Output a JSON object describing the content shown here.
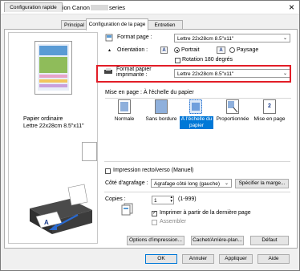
{
  "window": {
    "title_before": "Options d'impression Canon",
    "title_after": "series",
    "close_glyph": "×"
  },
  "tabs": [
    "Configuration rapide",
    "Principal",
    "Configuration de la page",
    "Entretien"
  ],
  "active_tab": 2,
  "preview": {
    "paper_type": "Papier ordinaire",
    "paper_size": "Lettre 22x28cm 8.5\"x11\""
  },
  "page_size": {
    "label": "Format page :",
    "value": "Lettre 22x28cm 8.5\"x11\""
  },
  "orientation": {
    "label": "Orientation :",
    "portrait": "Portrait",
    "landscape": "Paysage",
    "rotate180": "Rotation 180 degrés",
    "icon_letter": "A",
    "selected": "portrait"
  },
  "printer_paper": {
    "label_line1": "Format papier",
    "label_line2": "imprimante :",
    "value": "Lettre 22x28cm 8.5\"x11\""
  },
  "layout": {
    "label": "Mise en page :  À l'échelle du papier",
    "items": [
      {
        "label": "Normale"
      },
      {
        "label": "Sans bordure"
      },
      {
        "label": "À l'échelle du papier",
        "selected": true
      },
      {
        "label": "Proportionnée"
      },
      {
        "label": "Mise en page"
      }
    ],
    "mise_en_page_number": "2"
  },
  "duplex": {
    "label": "Impression recto/verso (Manuel)",
    "checked": false
  },
  "stapling": {
    "label": "Côté d'agrafage :",
    "value": "Agrafage côté long (gauche)",
    "button": "Spécifier la marge..."
  },
  "copies": {
    "label": "Copies :",
    "value": "1",
    "range": "(1-999)",
    "from_last": "Imprimer à partir de la dernière page",
    "from_last_checked": true,
    "collate": "Assembler",
    "collate_checked": false
  },
  "bottom_buttons": {
    "print_options": "Options d'impression...",
    "stamp": "Cachet/Arrière-plan...",
    "defaults": "Défaut"
  },
  "dialog_buttons": {
    "ok": "OK",
    "cancel": "Annuler",
    "apply": "Appliquer",
    "help": "Aide"
  },
  "colors": {
    "accent": "#0078d7",
    "highlight": "#e21d27"
  }
}
